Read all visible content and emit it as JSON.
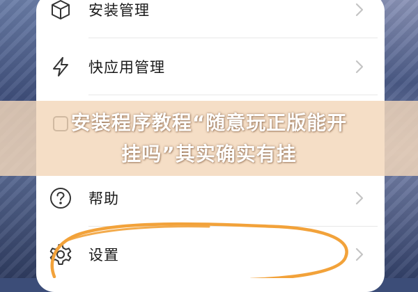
{
  "menu": {
    "items": [
      {
        "label": "安装管理",
        "icon": "package-icon"
      },
      {
        "label": "快应用管理",
        "icon": "lightning-icon"
      },
      {
        "label": "帮助",
        "icon": "help-icon"
      },
      {
        "label": "设置",
        "icon": "gear-icon"
      }
    ]
  },
  "overlay": {
    "headline_line1": "安装程序教程“随意玩正版能开",
    "headline_line2": "挂吗”其实确实有挂"
  },
  "colors": {
    "banner": "#f3d7ba",
    "annotation": "#f2a23a",
    "background": "#3c4d78"
  }
}
